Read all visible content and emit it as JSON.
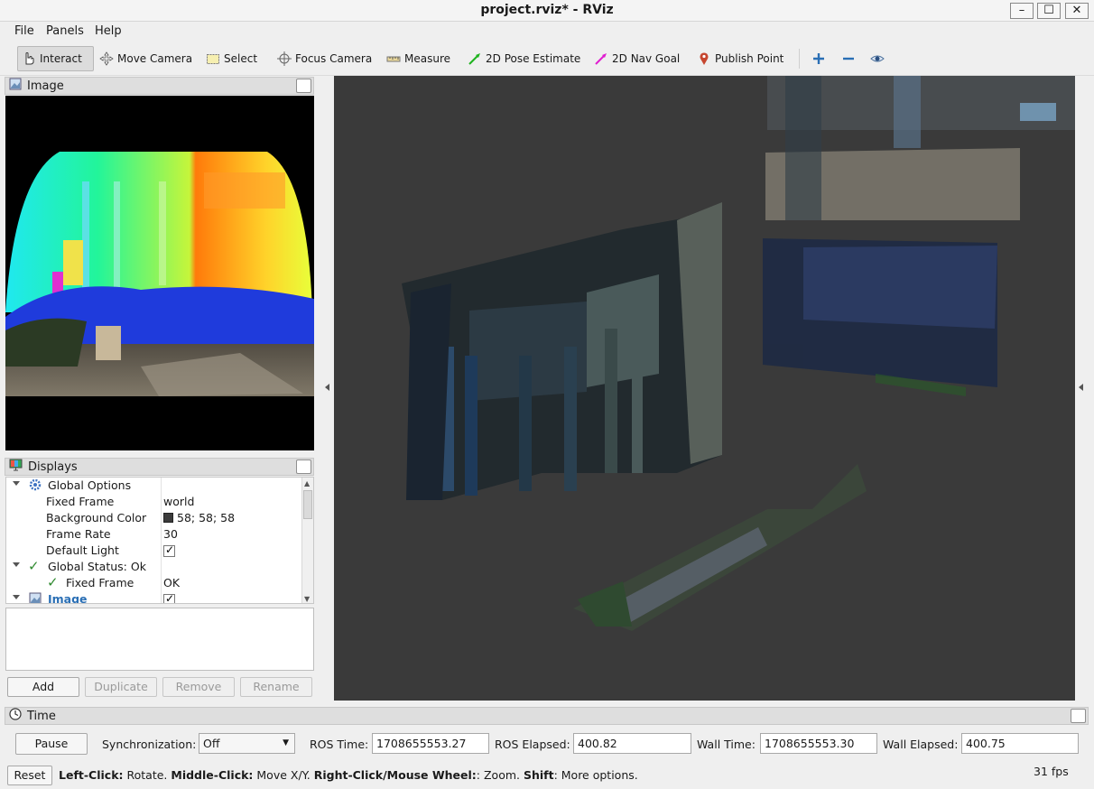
{
  "window": {
    "title": "project.rviz* - RViz"
  },
  "menu": {
    "file": "File",
    "panels": "Panels",
    "help": "Help"
  },
  "toolbar": {
    "interact": "Interact",
    "move_camera": "Move Camera",
    "select": "Select",
    "focus_camera": "Focus Camera",
    "measure": "Measure",
    "pose_estimate": "2D Pose Estimate",
    "nav_goal": "2D Nav Goal",
    "publish_point": "Publish Point"
  },
  "image_panel": {
    "title": "Image"
  },
  "displays_panel": {
    "title": "Displays",
    "global_options": "Global Options",
    "fixed_frame_label": "Fixed Frame",
    "fixed_frame_value": "world",
    "background_color_label": "Background Color",
    "background_color_value": "58; 58; 58",
    "frame_rate_label": "Frame Rate",
    "frame_rate_value": "30",
    "default_light_label": "Default Light",
    "global_status": "Global Status: Ok",
    "status_fixed_frame": "Fixed Frame",
    "status_fixed_frame_value": "OK",
    "image_item": "Image"
  },
  "display_buttons": {
    "add": "Add",
    "duplicate": "Duplicate",
    "remove": "Remove",
    "rename": "Rename"
  },
  "time_panel": {
    "title": "Time",
    "pause": "Pause",
    "sync_label": "Synchronization:",
    "sync_value": "Off",
    "ros_time_label": "ROS Time:",
    "ros_time": "1708655553.27",
    "ros_elapsed_label": "ROS Elapsed:",
    "ros_elapsed": "400.82",
    "wall_time_label": "Wall Time:",
    "wall_time": "1708655553.30",
    "wall_elapsed_label": "Wall Elapsed:",
    "wall_elapsed": "400.75"
  },
  "status": {
    "reset": "Reset",
    "left_click": "Left-Click:",
    "left_click_desc": " Rotate. ",
    "middle_click": "Middle-Click:",
    "middle_click_desc": " Move X/Y. ",
    "right_click": "Right-Click/Mouse Wheel:",
    "right_click_desc": ": Zoom. ",
    "shift": "Shift",
    "shift_desc": ": More options.",
    "fps": "31 fps"
  },
  "colors": {
    "background": "#3a3a3a",
    "ok": "#2f8a2f",
    "link": "#2a6fb5"
  }
}
